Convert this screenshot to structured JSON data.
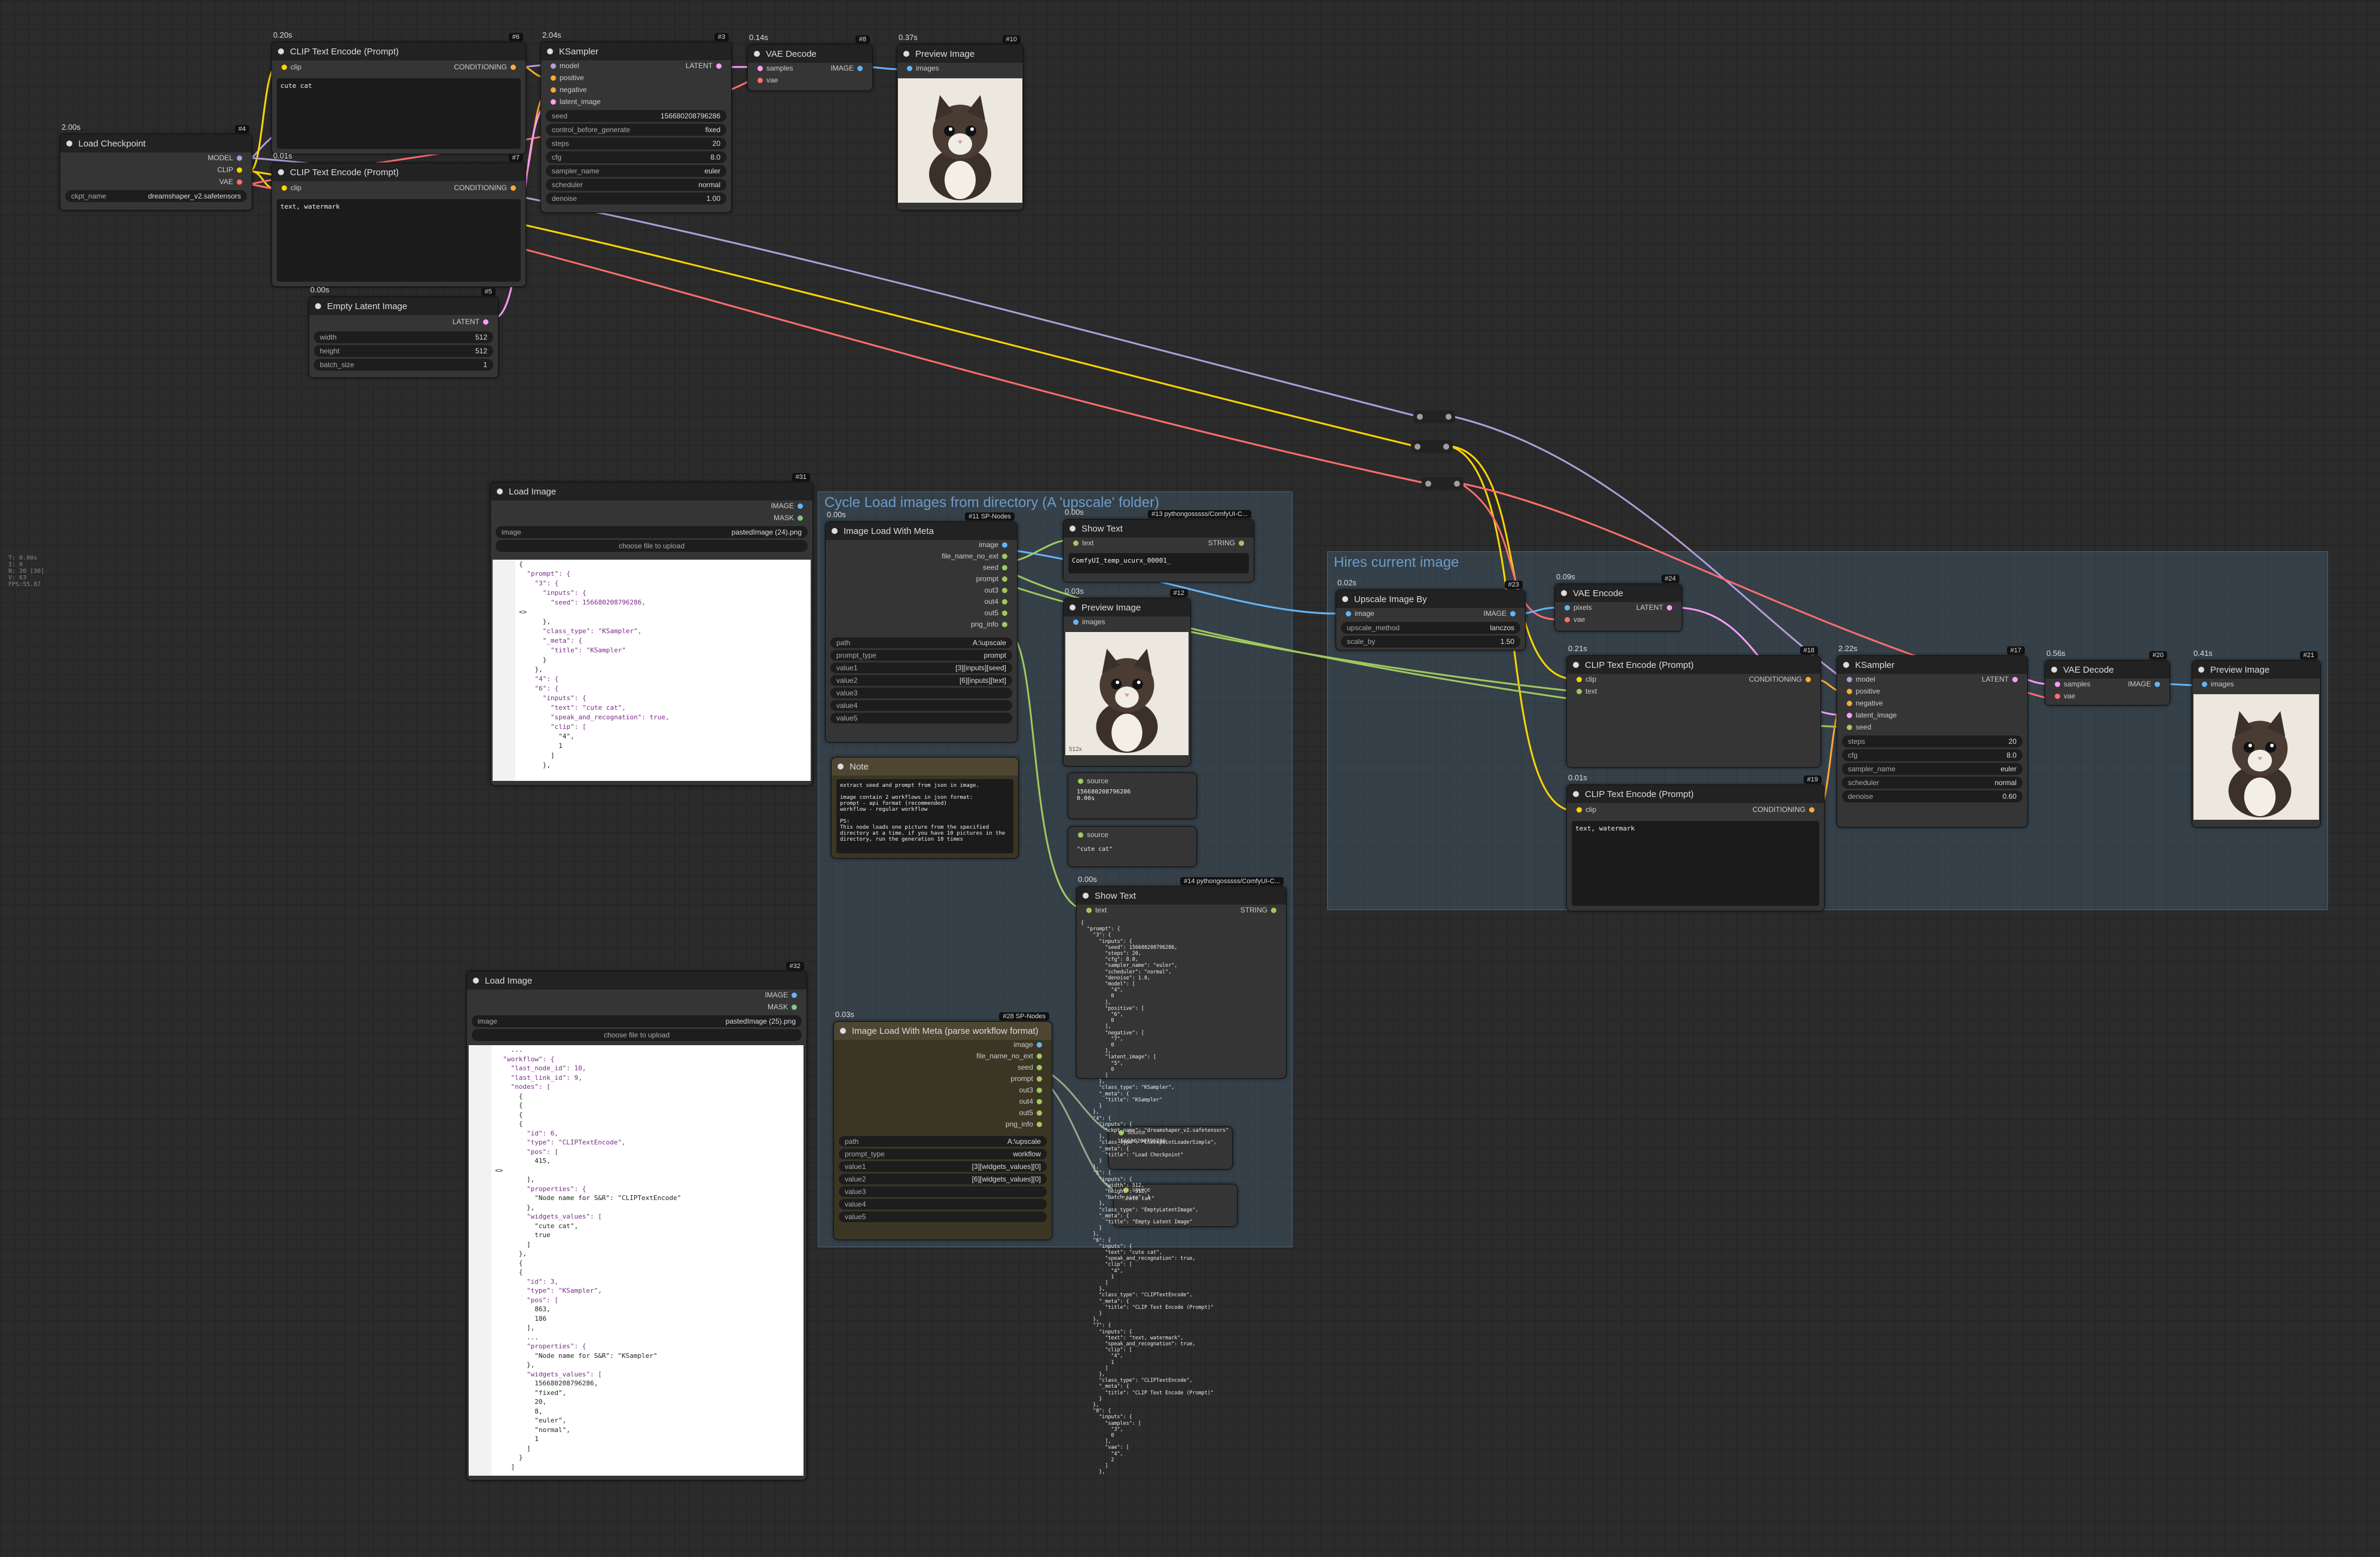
{
  "colors": {
    "model": "#b39ddb",
    "clip": "#ffd500",
    "vae": "#ff6e6e",
    "conditioning": "#ffa931",
    "latent": "#ff9cf9",
    "image": "#64b5f6",
    "string": "#a1c95e"
  },
  "groups": {
    "cycle_title": "Cycle Load images from directory (A 'upscale' folder)",
    "hires_title": "Hires current image"
  },
  "nodes": {
    "load_checkpoint": {
      "time": "2.00s",
      "id": "#4",
      "title": "Load Checkpoint",
      "outputs": [
        "MODEL",
        "CLIP",
        "VAE"
      ],
      "ckpt": "ckpt_name",
      "ckpt_value": "dreamshaper_v2.safetensors"
    },
    "clip1": {
      "time": "0.20s",
      "id": "#6",
      "title": "CLIP Text Encode (Prompt)",
      "in": "clip",
      "out": "CONDITIONING",
      "text": "cute cat"
    },
    "clip2": {
      "time": "0.01s",
      "id": "#7",
      "title": "CLIP Text Encode (Prompt)",
      "in": "clip",
      "out": "CONDITIONING",
      "text": "text, watermark"
    },
    "ksampler1": {
      "time": "2.04s",
      "id": "#3",
      "title": "KSampler",
      "inputs": [
        "model",
        "positive",
        "negative",
        "latent_image"
      ],
      "out": "LATENT",
      "widgets": [
        [
          "seed",
          "156680208796286"
        ],
        [
          "control_before_generate",
          "fixed"
        ],
        [
          "steps",
          "20"
        ],
        [
          "cfg",
          "8.0"
        ],
        [
          "sampler_name",
          "euler"
        ],
        [
          "scheduler",
          "normal"
        ],
        [
          "denoise",
          "1.00"
        ]
      ]
    },
    "vae1": {
      "time": "0.14s",
      "id": "#8",
      "title": "VAE Decode",
      "inputs": [
        "samples",
        "vae"
      ],
      "out": "IMAGE"
    },
    "preview1": {
      "time": "0.37s",
      "id": "#10",
      "title": "Preview Image",
      "in": "images"
    },
    "empty_latent": {
      "time": "0.00s",
      "id": "#5",
      "title": "Empty Latent Image",
      "out": "LATENT",
      "widgets": [
        [
          "width",
          "512"
        ],
        [
          "height",
          "512"
        ],
        [
          "batch_size",
          "1"
        ]
      ]
    },
    "load_image1": {
      "id": "#31",
      "title": "Load Image",
      "outs": [
        "IMAGE",
        "MASK"
      ],
      "image": "image",
      "image_value": "pastedImage (24).png",
      "upload": "choose file to upload"
    },
    "meta1": {
      "time": "0.00s",
      "id": "#11 SP-Nodes",
      "title": "Image Load With Meta",
      "outs": [
        "image",
        "file_name_no_ext",
        "seed",
        "prompt",
        "out3",
        "out4",
        "out5",
        "png_info"
      ],
      "widgets": [
        [
          "path",
          "A:\\upscale"
        ],
        [
          "prompt_type",
          "prompt"
        ],
        [
          "value1",
          "[3][inputs][seed]"
        ],
        [
          "value2",
          "[6][inputs][text]"
        ],
        [
          "value3",
          ""
        ],
        [
          "value4",
          ""
        ],
        [
          "value5",
          ""
        ]
      ]
    },
    "show1": {
      "time": "0.00s",
      "id": "#13 pythongosssss/ComfyUI-C...",
      "title": "Show Text",
      "in": "text",
      "out": "STRING",
      "text": "ComfyUI_temp_ucurx_00001_"
    },
    "preview2": {
      "time": "0.03s",
      "id": "#12",
      "title": "Preview Image",
      "in": "images",
      "caption": "512x"
    },
    "note": {
      "title": "Note",
      "text": "extract seed and prompt from json in image.\n\nimage contain 2 workflows in json format:\nprompt - api format (recommended)\nworkflow - regular workflow\n\nPS:\nThis node loads one picture from the specified\ndirectory at a time. if you have 10 pictures in the\ndirectory, run the generation 10 times"
    },
    "source1": {
      "label": "source",
      "value": "156680208796286",
      "time": "0.00s"
    },
    "source2": {
      "label": "source",
      "value": "\"cute cat\""
    },
    "show2": {
      "time": "0.00s",
      "id": "#14 pythongosssss/ComfyUI-C...",
      "title": "Show Text",
      "in": "text",
      "out": "STRING"
    },
    "load_image2": {
      "id": "#32",
      "title": "Load Image",
      "outs": [
        "IMAGE",
        "MASK"
      ],
      "image": "image",
      "image_value": "pastedImage (25).png",
      "upload": "choose file to upload"
    },
    "meta2": {
      "time": "0.03s",
      "id": "#28 SP-Nodes",
      "title": "Image Load With Meta (parse workflow format)",
      "outs": [
        "image",
        "file_name_no_ext",
        "seed",
        "prompt",
        "out3",
        "out4",
        "out5",
        "png_info"
      ],
      "widgets": [
        [
          "path",
          "A:\\upscale"
        ],
        [
          "prompt_type",
          "workflow"
        ],
        [
          "value1",
          "[3][widgets_values][0]"
        ],
        [
          "value2",
          "[6][widgets_values][0]"
        ],
        [
          "value3",
          ""
        ],
        [
          "value4",
          ""
        ],
        [
          "value5",
          ""
        ]
      ]
    },
    "upscale": {
      "time": "0.02s",
      "id": "#23",
      "title": "Upscale Image By",
      "in": "image",
      "out": "IMAGE",
      "widgets": [
        [
          "upscale_method",
          "lanczos"
        ],
        [
          "scale_by",
          "1.50"
        ]
      ]
    },
    "vae_enc": {
      "time": "0.09s",
      "id": "#24",
      "title": "VAE Encode",
      "inputs": [
        "pixels",
        "vae"
      ],
      "out": "LATENT"
    },
    "clip3": {
      "time": "0.21s",
      "id": "#18",
      "title": "CLIP Text Encode (Prompt)",
      "inputs": [
        "clip",
        "text"
      ],
      "out": "CONDITIONING"
    },
    "clip4": {
      "time": "0.01s",
      "id": "#19",
      "title": "CLIP Text Encode (Prompt)",
      "in": "clip",
      "out": "CONDITIONING",
      "text": "text, watermark"
    },
    "ksampler2": {
      "time": "2.22s",
      "id": "#17",
      "title": "KSampler",
      "inputs": [
        "model",
        "positive",
        "negative",
        "latent_image",
        "seed"
      ],
      "out": "LATENT",
      "widgets": [
        [
          "steps",
          "20"
        ],
        [
          "cfg",
          "8.0"
        ],
        [
          "sampler_name",
          "euler"
        ],
        [
          "scheduler",
          "normal"
        ],
        [
          "denoise",
          "0.60"
        ]
      ]
    },
    "vae2": {
      "time": "0.56s",
      "id": "#20",
      "title": "VAE Decode",
      "inputs": [
        "samples",
        "vae"
      ],
      "out": "IMAGE"
    },
    "preview3": {
      "time": "0.41s",
      "id": "#21",
      "title": "Preview Image",
      "in": "images"
    }
  },
  "code1": [
    [
      "1",
      "{"
    ],
    [
      "2",
      "  \"prompt\": {"
    ],
    [
      "3",
      "    \"3\": {"
    ],
    [
      "4",
      "      \"inputs\": {"
    ],
    [
      "5",
      "        \"seed\": 156680208796286,"
    ],
    [
      "6",
      "<>"
    ],
    [
      "7",
      "      },"
    ],
    [
      "8",
      "      \"class_type\": \"KSampler\","
    ],
    [
      "9",
      "      \"_meta\": {"
    ],
    [
      "10",
      "        \"title\": \"KSampler\""
    ],
    [
      "11",
      "      }"
    ],
    [
      "12",
      "    },"
    ],
    [
      "13",
      "    \"4\": {"
    ],
    [
      "14",
      "    \"6\": {"
    ],
    [
      "15",
      "      \"inputs\": {"
    ],
    [
      "16",
      "        \"text\": \"cute cat\","
    ],
    [
      "17",
      "        \"speak_and_recognation\": true,"
    ],
    [
      "18",
      "        \"clip\": ["
    ],
    [
      "19",
      "          \"4\","
    ],
    [
      "20",
      "          1"
    ],
    [
      "21",
      "        ]"
    ],
    [
      "22",
      "      },"
    ]
  ],
  "code2": [
    [
      "29",
      "    ..."
    ],
    [
      "30",
      "  \"workflow\": {"
    ],
    [
      "31",
      "    \"last_node_id\": 10,"
    ],
    [
      "32",
      "    \"last_link_id\": 9,"
    ],
    [
      "33",
      "    \"nodes\": ["
    ],
    [
      "34",
      "      {"
    ],
    [
      "133",
      "      {"
    ],
    [
      "134",
      "      {"
    ],
    [
      "214",
      "      {"
    ],
    [
      "215",
      "        \"id\": 6,"
    ],
    [
      "216",
      "        \"type\": \"CLIPTextEncode\","
    ],
    [
      "217",
      "        \"pos\": ["
    ],
    [
      "218",
      "          415,"
    ],
    [
      "219",
      "<>"
    ],
    [
      "220",
      "        ],"
    ],
    [
      "221",
      "        \"properties\": {"
    ],
    [
      "222",
      "          \"Node name for S&R\": \"CLIPTextEncode\""
    ],
    [
      "223",
      "        },"
    ],
    [
      "224",
      "        \"widgets_values\": ["
    ],
    [
      "225",
      "          \"cute cat\","
    ],
    [
      "226",
      "          true"
    ],
    [
      "227",
      "        ]"
    ],
    [
      "228",
      "      },"
    ],
    [
      "229",
      "      {"
    ],
    [
      "230",
      "      {"
    ],
    [
      "293",
      "        \"id\": 3,"
    ],
    [
      "294",
      "        \"type\": \"KSampler\","
    ],
    [
      "295",
      "        \"pos\": ["
    ],
    [
      "296",
      "          863,"
    ],
    [
      "297",
      "          186"
    ],
    [
      "298",
      "        ],"
    ],
    [
      "299",
      "        ..."
    ],
    [
      "300",
      "        \"properties\": {"
    ],
    [
      "301",
      "          \"Node name for S&R\": \"KSampler\""
    ],
    [
      "302",
      "        },"
    ],
    [
      "303",
      "        \"widgets_values\": ["
    ],
    [
      "304",
      "          156680208796286,"
    ],
    [
      "305",
      "          \"fixed\","
    ],
    [
      "306",
      "          20,"
    ],
    [
      "307",
      "          8,"
    ],
    [
      "308",
      "          \"euler\","
    ],
    [
      "309",
      "          \"normal\","
    ],
    [
      "310",
      "          1"
    ],
    [
      "311",
      "        ]"
    ],
    [
      "312",
      "      }"
    ],
    [
      "313",
      "    ]"
    ]
  ],
  "show2_text": "{\n  \"prompt\": {\n    \"3\": {\n      \"inputs\": {\n        \"seed\": 156680208796286,\n        \"steps\": 20,\n        \"cfg\": 8.0,\n        \"sampler_name\": \"euler\",\n        \"scheduler\": \"normal\",\n        \"denoise\": 1.0,\n        \"model\": [\n          \"4\",\n          0\n        ],\n        \"positive\": [\n          \"6\",\n          0\n        ],\n        \"negative\": [\n          \"7\",\n          0\n        ],\n        \"latent_image\": [\n          \"5\",\n          0\n        ]\n      },\n      \"class_type\": \"KSampler\",\n      \"_meta\": {\n        \"title\": \"KSampler\"\n      }\n    },\n    \"4\": {\n      \"inputs\": {\n        \"ckpt_name\": \"dreamshaper_v2.safetensors\"\n      },\n      \"class_type\": \"CheckpointLoaderSimple\",\n      \"_meta\": {\n        \"title\": \"Load Checkpoint\"\n      }\n    },\n    \"5\": {\n      \"inputs\": {\n        \"width\": 512,\n        \"height\": 512,\n        \"batch_size\": 1\n      },\n      \"class_type\": \"EmptyLatentImage\",\n      \"_meta\": {\n        \"title\": \"Empty Latent Image\"\n      }\n    },\n    \"6\": {\n      \"inputs\": {\n        \"text\": \"cute cat\",\n        \"speak_and_recognation\": true,\n        \"clip\": [\n          \"4\",\n          1\n        ]\n      },\n      \"class_type\": \"CLIPTextEncode\",\n      \"_meta\": {\n        \"title\": \"CLIP Text Encode (Prompt)\"\n      }\n    },\n    \"7\": {\n      \"inputs\": {\n        \"text\": \"text, watermark\",\n        \"speak_and_recognation\": true,\n        \"clip\": [\n          \"4\",\n          1\n        ]\n      },\n      \"class_type\": \"CLIPTextEncode\",\n      \"_meta\": {\n        \"title\": \"CLIP Text Encode (Prompt)\"\n      }\n    },\n    \"8\": {\n      \"inputs\": {\n        \"samples\": [\n          \"3\",\n          0\n        ],\n        \"vae\": [\n          \"4\",\n          2\n        ]\n      },",
  "mini_sources": {
    "a_label": "source",
    "a_value": "156680208796286",
    "b_label": "source",
    "b_value": "\"cute cat\"",
    "time": "0.00s"
  },
  "side_info": "T: 0.00s\nI: 0\nN: 30 [30]\nV: 63\nFPS:55.87"
}
